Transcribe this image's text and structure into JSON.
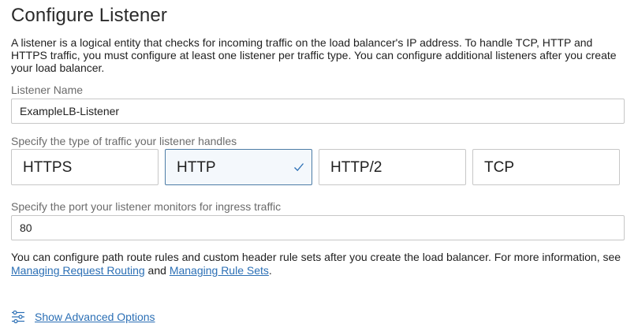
{
  "page": {
    "title": "Configure Listener",
    "intro": "A listener is a logical entity that checks for incoming traffic on the load balancer's IP address. To handle TCP, HTTP and HTTPS traffic, you must configure at least one listener per traffic type. You can configure additional listeners after you create your load balancer."
  },
  "listener_name": {
    "label": "Listener Name",
    "value": "ExampleLB-Listener"
  },
  "traffic": {
    "label": "Specify the type of traffic your listener handles",
    "options": [
      "HTTPS",
      "HTTP",
      "HTTP/2",
      "TCP"
    ],
    "selected": "HTTP"
  },
  "port": {
    "label": "Specify the port your listener monitors for ingress traffic",
    "value": "80"
  },
  "note": {
    "text_before": "You can configure path route rules and custom header rule sets after you create the load balancer. For more information, see ",
    "link1": "Managing Request Routing",
    "text_between": " and ",
    "link2": "Managing Rule Sets",
    "text_after": "."
  },
  "advanced": {
    "link": "Show Advanced Options",
    "icon": "sliders-icon"
  },
  "colors": {
    "link": "#2b6fb5",
    "selected_border": "#4d7ca6",
    "selected_bg": "#f4f8fc",
    "check": "#2b6fb5"
  }
}
